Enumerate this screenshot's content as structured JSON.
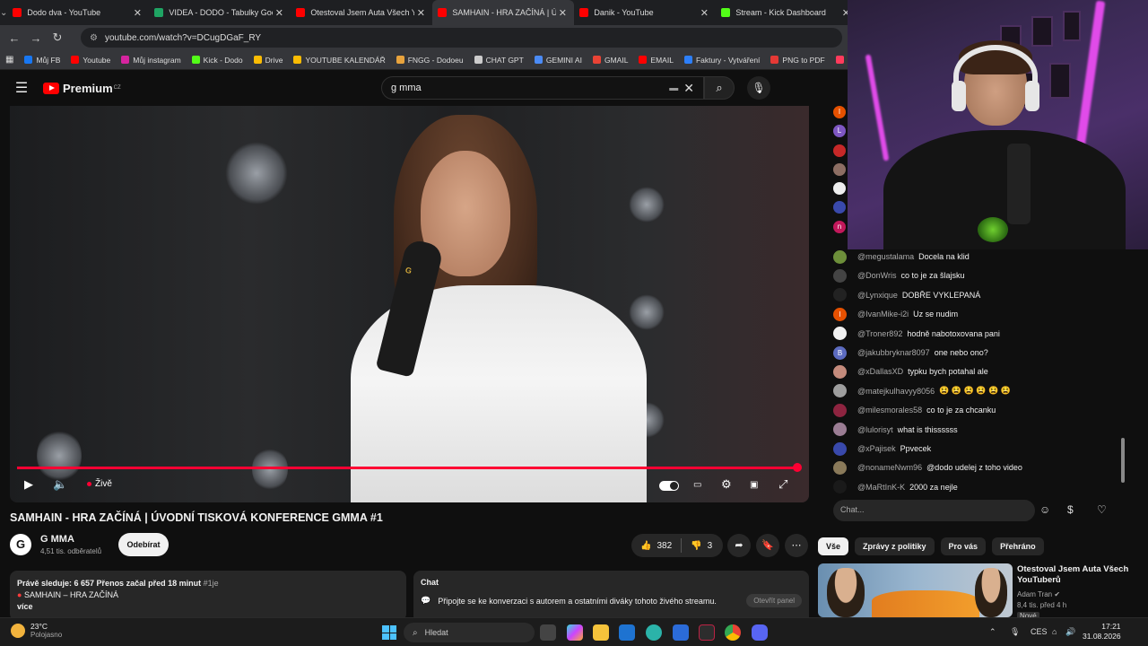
{
  "browser": {
    "tabs": [
      {
        "title": "Dodo dva - YouTube",
        "color": "#ff0000"
      },
      {
        "title": "VIDEA - DODO - Tabulky Googl",
        "color": "#1fa463"
      },
      {
        "title": "Otestoval Jsem Auta Všech You",
        "color": "#ff0000"
      },
      {
        "title": "SAMHAIN - HRA ZAČÍNÁ | ÚVO",
        "color": "#ff0000"
      },
      {
        "title": "Danik - YouTube",
        "color": "#ff0000"
      },
      {
        "title": "Stream - Kick Dashboard",
        "color": "#53fc18"
      }
    ],
    "url": "youtube.com/watch?v=DCugDGaF_RY",
    "bookmarks": [
      {
        "label": "Můj FB",
        "color": "#1877f2"
      },
      {
        "label": "Youtube",
        "color": "#ff0000"
      },
      {
        "label": "Můj instagram",
        "color": "#d6249f"
      },
      {
        "label": "Kick - Dodo",
        "color": "#53fc18"
      },
      {
        "label": "Drive",
        "color": "#fbbc04"
      },
      {
        "label": "YOUTUBE KALENDÁŘ",
        "color": "#fbbc04"
      },
      {
        "label": "FNGG - Dodoeu",
        "color": "#e8a33d"
      },
      {
        "label": "CHAT GPT",
        "color": "#cccccc"
      },
      {
        "label": "GEMINI AI",
        "color": "#4b8bf5"
      },
      {
        "label": "GMAIL",
        "color": "#ea4335"
      },
      {
        "label": "EMAIL",
        "color": "#ff0000"
      },
      {
        "label": "Faktury - Vytváření",
        "color": "#2d7ff9"
      },
      {
        "label": "PNG to PDF",
        "color": "#e53935"
      },
      {
        "label": "http",
        "color": "#ff3b5c"
      }
    ]
  },
  "youtube": {
    "brand": "Premium",
    "region": "CZ",
    "search_value": "g mma",
    "video": {
      "progress": 0.995,
      "live_label": "Živě"
    },
    "title": "SAMHAIN - HRA ZAČÍNÁ | ÚVODNÍ TISKOVÁ KONFERENCE GMMA #1",
    "channel": {
      "avatar_letter": "G",
      "name": "G MMA",
      "subs": "4,51 tis. odběratelů",
      "subscribe_label": "Odebírat"
    },
    "likes": "382",
    "dislikes": "3",
    "description": {
      "line1_bold": "Právě sleduje: 6 657  Přenos začal před 18 minut",
      "hashtag": "#1je",
      "line2": "SAMHAIN – HRA ZAČÍNÁ",
      "more": "více"
    },
    "chat_panel": {
      "header": "Chat",
      "text": "Připojte se ke konverzaci s autorem a ostatními diváky tohoto živého streamu.",
      "open_label": "Otevřít panel"
    }
  },
  "live_chat": {
    "side_avatars": [
      {
        "letter": "I",
        "color": "#e65100"
      },
      {
        "letter": "L",
        "color": "#7e57c2"
      },
      {
        "letter": "",
        "color": "#c62828"
      },
      {
        "letter": "",
        "color": "#8d6e63"
      },
      {
        "letter": "",
        "color": "#eeeeee"
      },
      {
        "letter": "",
        "color": "#3949ab"
      },
      {
        "letter": "n",
        "color": "#c2185b"
      }
    ],
    "messages": [
      {
        "user": "@megustalama",
        "text": "Docela na klid",
        "letter": "",
        "color": "#6d8f3a"
      },
      {
        "user": "@DonWris",
        "text": "co to je za šlajsku",
        "letter": "",
        "color": "#444444"
      },
      {
        "user": "@Lynxique",
        "text": "DOBŘE VYKLEPANÁ",
        "letter": "",
        "color": "#222222"
      },
      {
        "user": "@IvanMike-i2i",
        "text": "Uz se nudim",
        "letter": "I",
        "color": "#e65100"
      },
      {
        "user": "@Troner892",
        "text": "hodně nabotoxovana pani",
        "letter": "",
        "color": "#f1f1f1"
      },
      {
        "user": "@jakubbryknar8097",
        "text": "one nebo ono?",
        "letter": "B",
        "color": "#5c6bc0"
      },
      {
        "user": "@xDallasXD",
        "text": "typku bych potahal ale",
        "letter": "",
        "color": "#c48b7c"
      },
      {
        "user": "@matejkulhavyy8056",
        "text": "😫 😫 😫 😫 😫 😫",
        "letter": "",
        "color": "#9e9e9e"
      },
      {
        "user": "@milesmorales58",
        "text": "co to je za chcanku",
        "letter": "",
        "color": "#8e2440"
      },
      {
        "user": "@lulorisyt",
        "text": "what is thissssss",
        "letter": "",
        "color": "#9b7d94"
      },
      {
        "user": "@xPajisek",
        "text": "Ppvecek",
        "letter": "",
        "color": "#3949ab"
      },
      {
        "user": "@nonameNwm96",
        "text": "@dodo udelej z toho video",
        "letter": "",
        "color": "#8a7a5a"
      },
      {
        "user": "@MaRtInK-K",
        "text": "2000 za nejle",
        "letter": "",
        "color": "#1a1a1a"
      }
    ],
    "input_placeholder": "Chat...",
    "chips": [
      "Vše",
      "Zprávy z politiky",
      "Pro vás",
      "Přehráno"
    ]
  },
  "recommendation": {
    "title": "Otestoval Jsem Auta Všech YouTuberů",
    "channel": "Adam Tran",
    "meta": "8,4 tis.  před 4 h",
    "badge": "Nové"
  },
  "taskbar": {
    "temp": "23°C",
    "weather": "Polojasno",
    "search_placeholder": "Hledat",
    "lang": "CES",
    "time": "17:21",
    "date": "31.08.2026"
  }
}
